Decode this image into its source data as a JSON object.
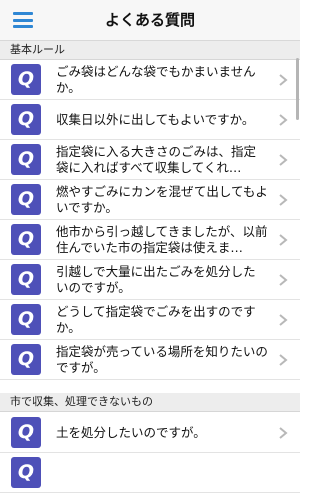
{
  "header": {
    "title": "よくある質問",
    "menu_icon": "hamburger-menu-icon",
    "accent_color": "#2f87d4"
  },
  "sections": [
    {
      "label": "基本ルール",
      "items": [
        {
          "badge": "Q",
          "text": "ごみ袋はどんな袋でもかまいませんか。"
        },
        {
          "badge": "Q",
          "text": "収集日以外に出してもよいですか。"
        },
        {
          "badge": "Q",
          "text": "指定袋に入る大きさのごみは、指定袋に入ればすべて収集してくれ…"
        },
        {
          "badge": "Q",
          "text": "燃やすごみにカンを混ぜて出してもよいですか。"
        },
        {
          "badge": "Q",
          "text": "他市から引っ越してきましたが、以前住んでいた市の指定袋は使えま…"
        },
        {
          "badge": "Q",
          "text": "引越しで大量に出たごみを処分したいのですが。"
        },
        {
          "badge": "Q",
          "text": "どうして指定袋でごみを出すのですか。"
        },
        {
          "badge": "Q",
          "text": "指定袋が売っている場所を知りたいのですが。"
        }
      ]
    },
    {
      "label": "市で収集、処理できないもの",
      "items": [
        {
          "badge": "Q",
          "text": "土を処分したいのですが。"
        },
        {
          "badge": "Q",
          "text": ""
        }
      ]
    }
  ],
  "badge_color": "#4e50b8",
  "chevron_icon": "chevron-right-icon"
}
